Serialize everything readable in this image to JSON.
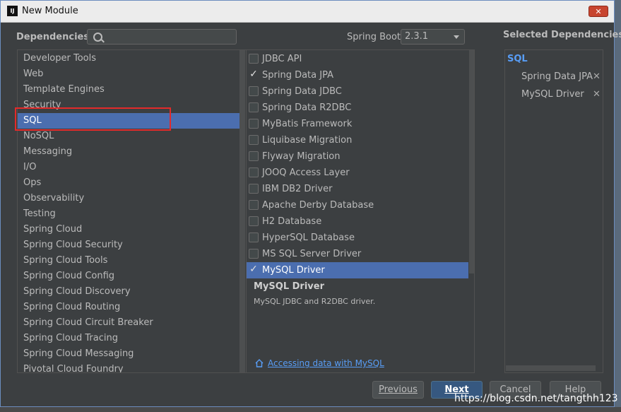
{
  "window": {
    "title": "New Module",
    "app_icon": "IJ",
    "close_label": "✕"
  },
  "header": {
    "dependencies_label": "Dependencies",
    "search_placeholder": "",
    "spring_boot_label": "Spring Boot",
    "spring_boot_version": "2.3.1"
  },
  "categories": [
    {
      "label": "Developer Tools"
    },
    {
      "label": "Web"
    },
    {
      "label": "Template Engines"
    },
    {
      "label": "Security"
    },
    {
      "label": "SQL",
      "selected": true
    },
    {
      "label": "NoSQL"
    },
    {
      "label": "Messaging"
    },
    {
      "label": "I/O"
    },
    {
      "label": "Ops"
    },
    {
      "label": "Observability"
    },
    {
      "label": "Testing"
    },
    {
      "label": "Spring Cloud"
    },
    {
      "label": "Spring Cloud Security"
    },
    {
      "label": "Spring Cloud Tools"
    },
    {
      "label": "Spring Cloud Config"
    },
    {
      "label": "Spring Cloud Discovery"
    },
    {
      "label": "Spring Cloud Routing"
    },
    {
      "label": "Spring Cloud Circuit Breaker"
    },
    {
      "label": "Spring Cloud Tracing"
    },
    {
      "label": "Spring Cloud Messaging"
    },
    {
      "label": "Pivotal Cloud Foundry"
    }
  ],
  "dependencies": [
    {
      "label": "JDBC API",
      "checked": false
    },
    {
      "label": "Spring Data JPA",
      "checked": true
    },
    {
      "label": "Spring Data JDBC",
      "checked": false
    },
    {
      "label": "Spring Data R2DBC",
      "checked": false
    },
    {
      "label": "MyBatis Framework",
      "checked": false
    },
    {
      "label": "Liquibase Migration",
      "checked": false
    },
    {
      "label": "Flyway Migration",
      "checked": false
    },
    {
      "label": "JOOQ Access Layer",
      "checked": false
    },
    {
      "label": "IBM DB2 Driver",
      "checked": false
    },
    {
      "label": "Apache Derby Database",
      "checked": false
    },
    {
      "label": "H2 Database",
      "checked": false
    },
    {
      "label": "HyperSQL Database",
      "checked": false
    },
    {
      "label": "MS SQL Server Driver",
      "checked": false
    },
    {
      "label": "MySQL Driver",
      "checked": true,
      "selected": true
    }
  ],
  "description": {
    "title": "MySQL Driver",
    "text": "MySQL JDBC and R2DBC driver.",
    "link": "Accessing data with MySQL"
  },
  "selected_panel": {
    "title": "Selected Dependencies",
    "group": "SQL",
    "items": [
      "Spring Data JPA",
      "MySQL Driver"
    ],
    "remove_label": "✕"
  },
  "buttons": {
    "previous": "Previous",
    "next": "Next",
    "cancel": "Cancel",
    "help": "Help"
  },
  "watermark": "https://blog.csdn.net/tangthh123",
  "colors": {
    "selection": "#4b6eaf",
    "link": "#589df6",
    "highlight_box": "#e32a2a"
  }
}
